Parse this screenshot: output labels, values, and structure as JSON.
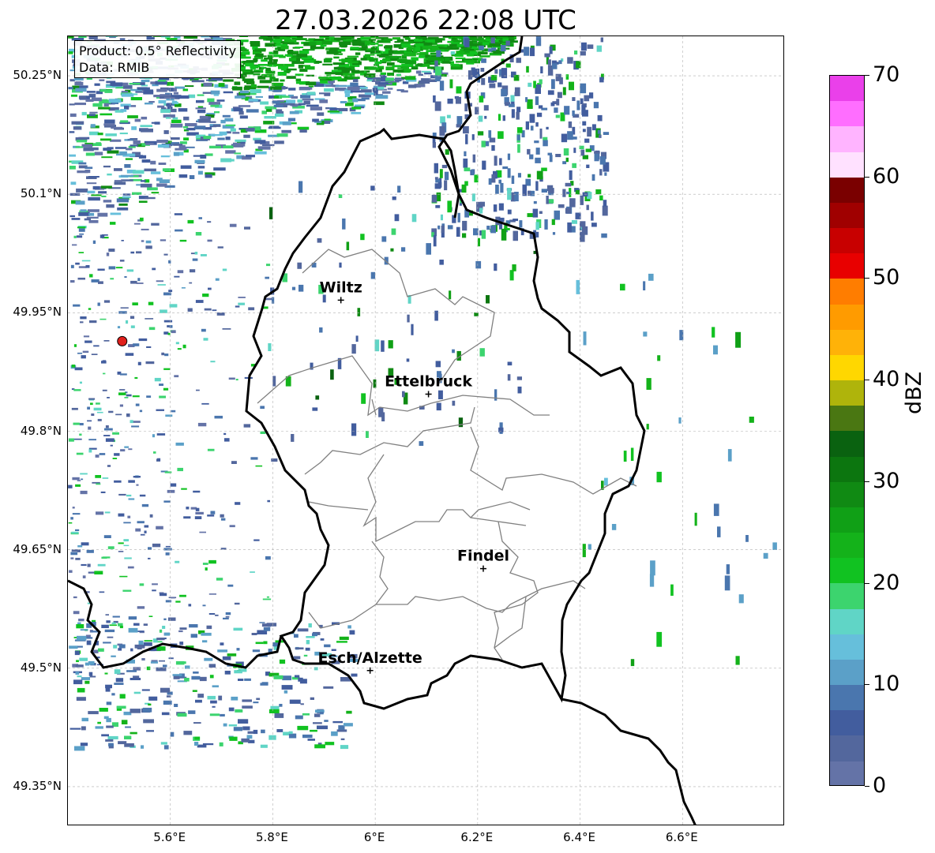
{
  "title": "27.03.2026 22:08 UTC",
  "info_box": {
    "line1": "Product: 0.5° Reflectivity",
    "line2": "Data: RMIB"
  },
  "map": {
    "lat_labels": [
      "50.25°N",
      "50.1°N",
      "49.95°N",
      "49.8°N",
      "49.65°N",
      "49.5°N",
      "49.35°N"
    ],
    "lat_values": [
      50.25,
      50.1,
      49.95,
      49.8,
      49.65,
      49.5,
      49.35
    ],
    "lon_labels": [
      "5.6°E",
      "5.8°E",
      "6°E",
      "6.2°E",
      "6.4°E",
      "6.6°E"
    ],
    "lon_values": [
      5.6,
      5.8,
      6.0,
      6.2,
      6.4,
      6.6
    ],
    "extent": {
      "lon_min": 5.4,
      "lon_max": 6.8,
      "lat_min": 49.3,
      "lat_max": 50.3
    },
    "cities": [
      {
        "name": "Wiltz",
        "lon": 5.933,
        "lat": 49.966
      },
      {
        "name": "Ettelbruck",
        "lon": 6.104,
        "lat": 49.847
      },
      {
        "name": "Findel",
        "lon": 6.211,
        "lat": 49.626
      },
      {
        "name": "Esch/Alzette",
        "lon": 5.99,
        "lat": 49.497
      }
    ],
    "radar_site": {
      "lon": 5.506,
      "lat": 49.914
    },
    "colors": {
      "border": "#000000",
      "cantons": "#808080",
      "grid": "#b0b0b0",
      "radar_site": "#e0201c"
    }
  },
  "colorbar": {
    "label": "dBZ",
    "ticks": [
      "70",
      "60",
      "50",
      "40",
      "30",
      "20",
      "10",
      "0"
    ],
    "tick_values": [
      70,
      60,
      50,
      40,
      30,
      20,
      10,
      0
    ],
    "min": 0,
    "max": 70,
    "step": 2.5,
    "colors": [
      "#6473a7",
      "#53679d",
      "#425d9e",
      "#4a76ae",
      "#5ba0c8",
      "#66bfdb",
      "#60d5c6",
      "#3cd46e",
      "#11c221",
      "#14b21a",
      "#10a016",
      "#108a13",
      "#0c760f",
      "#0a6210",
      "#4a7712",
      "#afb40b",
      "#ffd700",
      "#ffb208",
      "#ff9b00",
      "#ff7d00",
      "#e80000",
      "#c80000",
      "#a00000",
      "#7a0000",
      "#ffe1ff",
      "#ffb4ff",
      "#ff6eff",
      "#ea40ea"
    ]
  }
}
